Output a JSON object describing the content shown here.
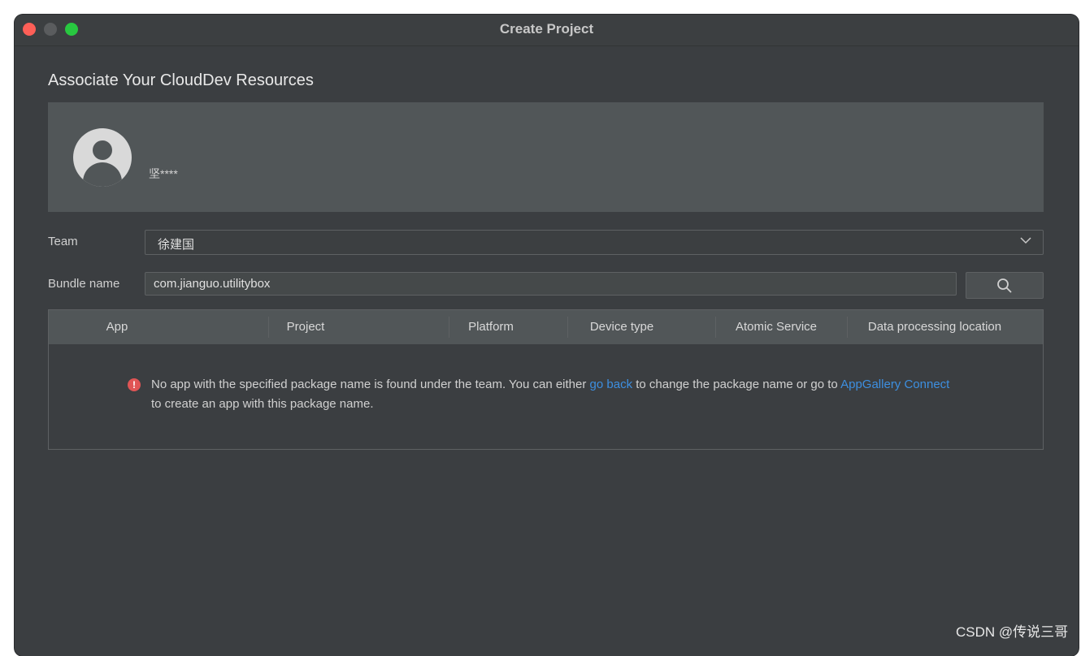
{
  "window": {
    "title": "Create Project"
  },
  "heading": "Associate Your CloudDev Resources",
  "account": {
    "username": "坚****"
  },
  "team": {
    "label": "Team",
    "value": "徐建国"
  },
  "bundle": {
    "label": "Bundle name",
    "value": "com.jianguo.utilitybox"
  },
  "table": {
    "columns": [
      "App",
      "Project",
      "Platform",
      "Device type",
      "Atomic Service",
      "Data processing location"
    ]
  },
  "message": {
    "part1": "No app with the specified package name is found under the team. You can either ",
    "link1": "go back",
    "part2": " to change the package name or go to ",
    "link2": "AppGallery Connect",
    "part3": " to create an app with this package name."
  },
  "watermark": "CSDN @传说三哥",
  "colors": {
    "background": "#3b3e41",
    "panel": "#515658",
    "link": "#3d8fe0",
    "error": "#e05555"
  }
}
